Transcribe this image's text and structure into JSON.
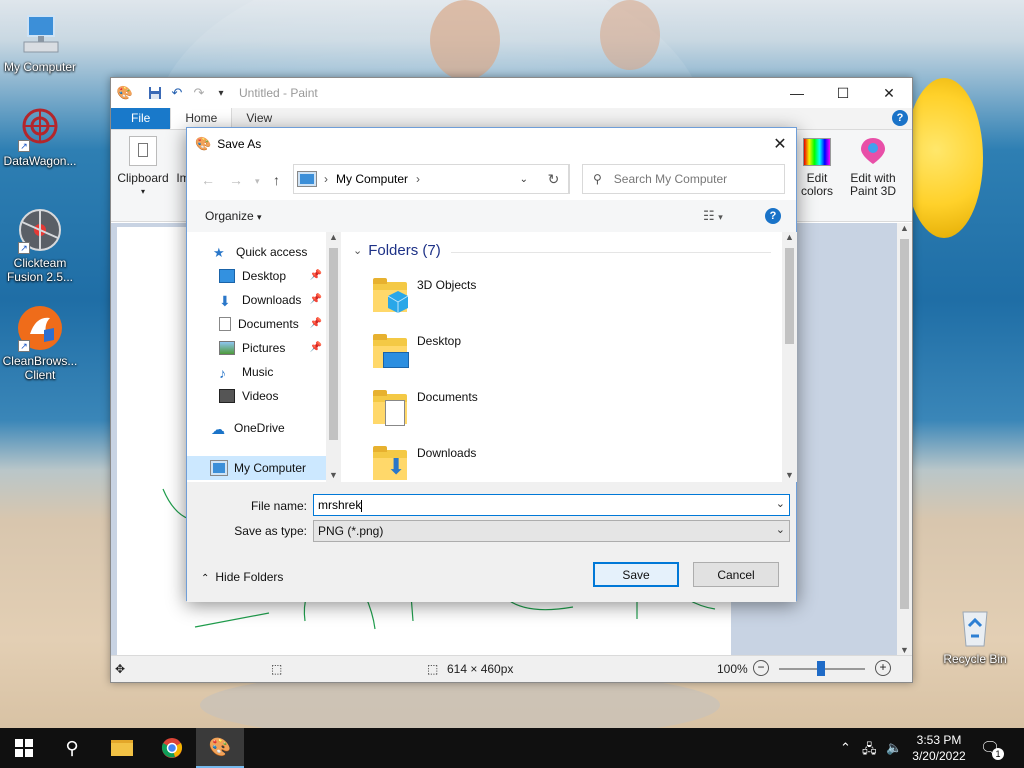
{
  "desktop": {
    "icons": [
      {
        "label": "My Computer",
        "icon": "computer-icon"
      },
      {
        "label": "DataWagon...",
        "icon": "datawagon-icon"
      },
      {
        "label": "Clickteam Fusion 2.5...",
        "icon": "clickteam-icon"
      },
      {
        "label": "CleanBrows... Client",
        "icon": "cleanbrowsing-icon"
      },
      {
        "label": "Recycle Bin",
        "icon": "recycle-bin-icon"
      }
    ]
  },
  "paint": {
    "title": "Untitled - Paint",
    "tabs": {
      "file": "File",
      "home": "Home",
      "view": "View"
    },
    "ribbon": {
      "clipboard": "Clipboard",
      "image_partial": "Im",
      "edit_colors": "Edit colors",
      "edit_paint3d": "Edit with Paint 3D"
    },
    "status": {
      "canvas_size": "614 × 460px",
      "zoom": "100%"
    }
  },
  "dialog": {
    "title": "Save As",
    "address": "My Computer",
    "search_placeholder": "Search My Computer",
    "organize": "Organize",
    "nav": {
      "quick_access": "Quick access",
      "desktop": "Desktop",
      "downloads": "Downloads",
      "documents": "Documents",
      "pictures": "Pictures",
      "music": "Music",
      "videos": "Videos",
      "onedrive": "OneDrive",
      "my_computer": "My Computer"
    },
    "group_header": "Folders (7)",
    "folders": [
      "3D Objects",
      "Desktop",
      "Documents",
      "Downloads"
    ],
    "file_name_label": "File name:",
    "file_name_value": "mrshrek",
    "save_type_label": "Save as type:",
    "save_type_value": "PNG (*.png)",
    "hide_folders": "Hide Folders",
    "save_button": "Save",
    "cancel_button": "Cancel"
  },
  "taskbar": {
    "time": "3:53 PM",
    "date": "3/20/2022",
    "notification_count": "1"
  }
}
